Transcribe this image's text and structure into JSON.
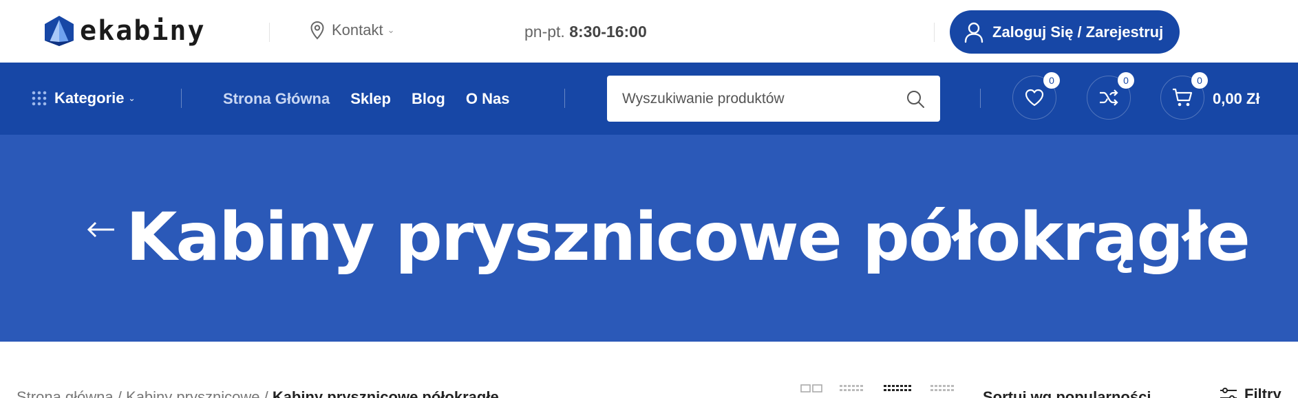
{
  "topbar": {
    "logo_text": "ekabiny",
    "contact_label": "Kontakt",
    "hours_prefix": "pn-pt.",
    "hours_value": "8:30-16:00",
    "login_label": "Zaloguj Się / Zarejestruj"
  },
  "nav": {
    "categories_label": "Kategorie",
    "links": [
      "Strona Główna",
      "Sklep",
      "Blog",
      "O Nas"
    ],
    "search_placeholder": "Wyszukiwanie produktów",
    "wishlist_count": "0",
    "compare_count": "0",
    "cart_count": "0",
    "cart_total": "0,00 Zł"
  },
  "hero": {
    "title": "Kabiny prysznicowe półokrągłe"
  },
  "bottom": {
    "breadcrumb": [
      "Strona główna",
      "Kabiny prysznicowe",
      "Kabiny prysznicowe półokrągłe"
    ],
    "sort_label": "Sortuj wg popularności",
    "filter_label": "Filtry"
  },
  "colors": {
    "brand": "#1747a6",
    "hero": "#2b59b8"
  }
}
